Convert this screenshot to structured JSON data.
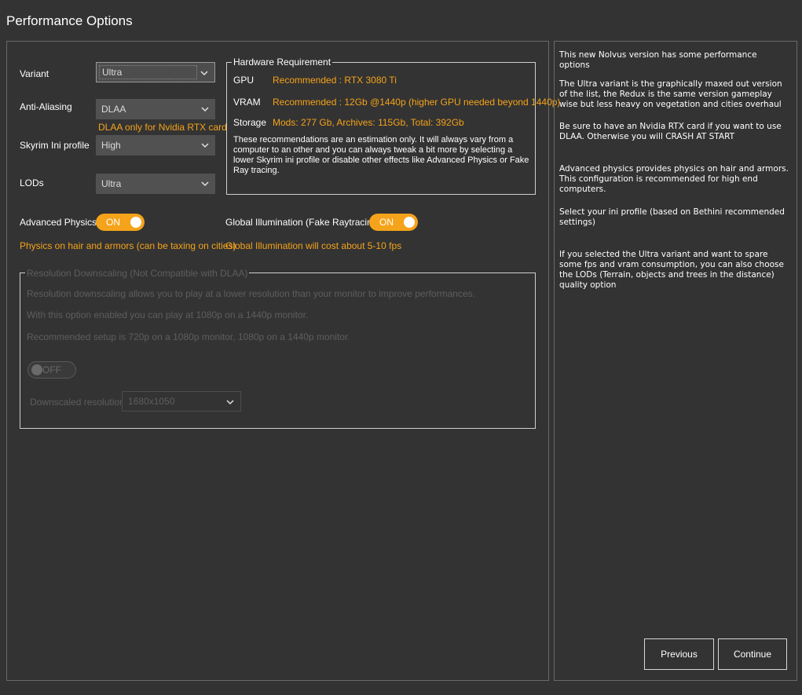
{
  "window": {
    "title": "Performance Options"
  },
  "settings": {
    "variant": {
      "label": "Variant",
      "value": "Ultra"
    },
    "anti_aliasing": {
      "label": "Anti-Aliasing",
      "value": "DLAA",
      "note": "DLAA only for Nvidia RTX card"
    },
    "ini_profile": {
      "label": "Skyrim Ini profile",
      "value": "High"
    },
    "lods": {
      "label": "LODs",
      "value": "Ultra"
    },
    "advanced_physics": {
      "label": "Advanced Physics",
      "state": "ON",
      "note": "Physics on hair and armors (can be taxing on cities)"
    },
    "global_illumination": {
      "label": "Global Illumination (Fake Raytracing)",
      "state": "ON",
      "note": "Global Illumination will cost about 5-10 fps"
    }
  },
  "hardware": {
    "legend": "Hardware Requirement",
    "gpu": {
      "label": "GPU",
      "value": "Recommended : RTX 3080 Ti"
    },
    "vram": {
      "label": "VRAM",
      "value": "Recommended : 12Gb @1440p (higher GPU needed beyond 1440p)"
    },
    "storage": {
      "label": "Storage",
      "value": "Mods: 277 Gb, Archives: 115Gb, Total: 392Gb"
    },
    "disclaimer": "These recommendations are an estimation only. It will always vary from a computer to an other and you can always tweak a bit more by selecting a lower Skyrim ini profile or disable other effects like Advanced Physics or Fake Ray tracing."
  },
  "downscaling": {
    "legend": "Resolution Downscaling (Not Compatible with DLAA)",
    "line1": "Resolution downscaling allows you to play at a lower resolution than your monitor to improve performances.",
    "line2": "With this option enabled you can play at 1080p on a 1440p monitor.",
    "line3": "Recommended setup is 720p on a 1080p monitor, 1080p on a 1440p monitor.",
    "toggle_state": "OFF",
    "resolution_label": "Downscaled resolution",
    "resolution_value": "1680x1050"
  },
  "info": {
    "p1": "This new Nolvus version has some performance options",
    "p2": "The Ultra variant is the graphically maxed out version of the list, the Redux is the same version gameplay wise but less heavy on vegetation and cities overhaul",
    "p3": "Be sure to have an Nvidia RTX card if you want to use DLAA. Otherwise you will CRASH AT START",
    "p4": "Advanced physics provides physics on hair and armors. This configuration is recommended for high end computers.",
    "p5": "Select your ini profile (based on Bethini recommended settings)",
    "p6": "If you selected the Ultra variant and want to spare some fps and vram consumption, you can also choose the LODs (Terrain, objects and trees in the distance) quality option"
  },
  "buttons": {
    "previous": "Previous",
    "continue": "Continue"
  },
  "colors": {
    "background": "#333333",
    "accent": "#f5a31a",
    "border": "#6a6a6a"
  },
  "icons": {
    "dropdown": "chevron-down-icon",
    "toggle_knob": "toggle-knob-icon"
  }
}
